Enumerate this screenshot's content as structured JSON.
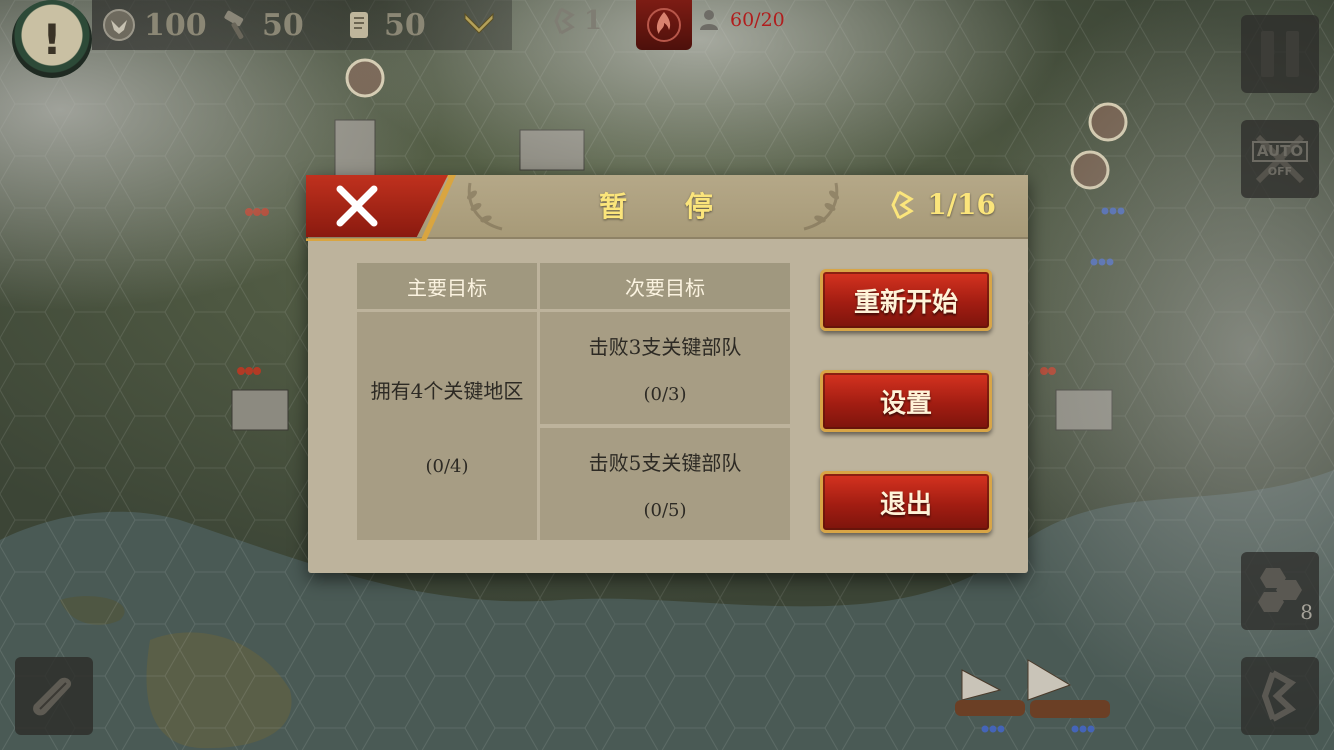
{
  "topbar": {
    "alert_glyph": "!",
    "resources": [
      {
        "icon": "eagle-emblem-icon",
        "value": "100"
      },
      {
        "icon": "hammer-icon",
        "value": "50"
      },
      {
        "icon": "scroll-icon",
        "value": "50"
      }
    ],
    "strategy_points": "1",
    "population": "60/20"
  },
  "dialog": {
    "title": "暂 停",
    "turn": "1/16",
    "objectives": {
      "primary_header": "主要目标",
      "secondary_header": "次要目标",
      "primary": [
        {
          "text": "拥有4个关键地区",
          "progress": "(0/4)"
        }
      ],
      "secondary": [
        {
          "text": "击败3支关键部队",
          "progress": "(0/3)"
        },
        {
          "text": "击败5支关键部队",
          "progress": "(0/5)"
        }
      ]
    },
    "buttons": {
      "restart": "重新开始",
      "settings": "设置",
      "exit": "退出"
    }
  },
  "side": {
    "auto_label": "AUTO",
    "auto_state": "OFF",
    "hex_count": "8"
  },
  "colors": {
    "accent_gold": "#fbe57b",
    "button_red": "#b8251a",
    "population_red": "#b11d1d",
    "panel": "#bdb39c"
  }
}
